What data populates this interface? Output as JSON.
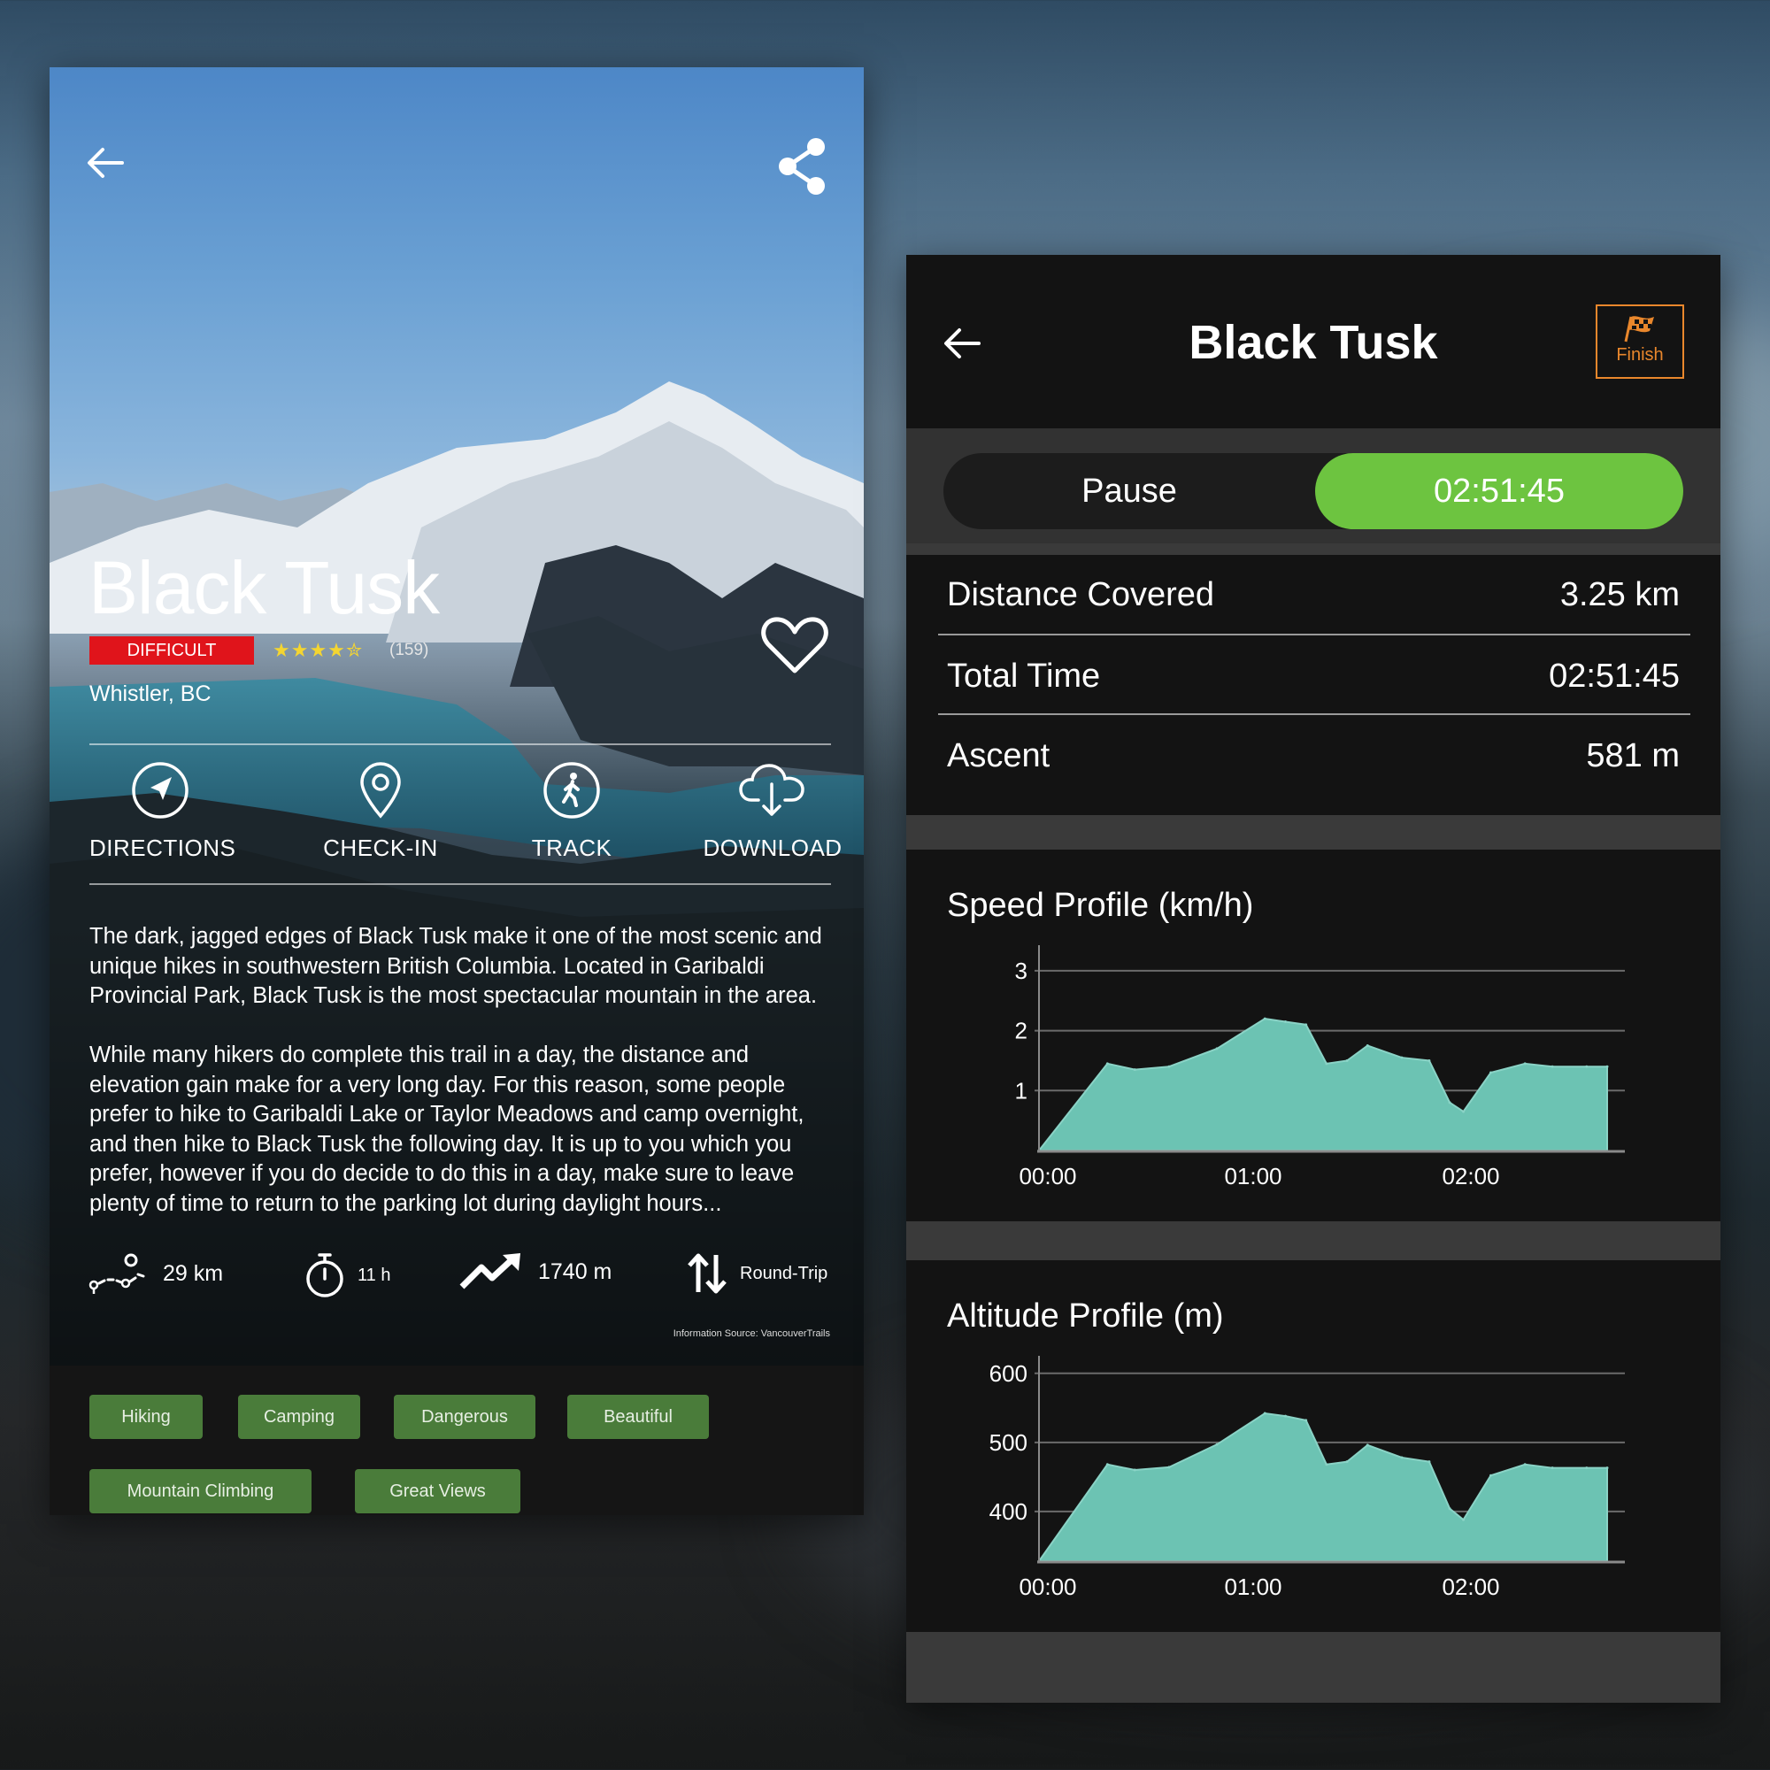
{
  "left": {
    "title": "Black Tusk",
    "difficulty": "DIFFICULT",
    "stars": "★★★★✮",
    "rating": 4.5,
    "review_count": "(159)",
    "location": "Whistler, BC",
    "actions": [
      {
        "label": "DIRECTIONS",
        "icon": "navigation-icon"
      },
      {
        "label": "CHECK-IN",
        "icon": "map-pin-icon"
      },
      {
        "label": "TRACK",
        "icon": "hiker-icon"
      },
      {
        "label": "DOWNLOAD",
        "icon": "cloud-download-icon"
      }
    ],
    "description": [
      "The dark, jagged edges of Black Tusk make it one of the most scenic and unique hikes in southwestern British Columbia. Located in Garibaldi Provincial Park, Black Tusk is the most spectacular mountain in the area.",
      "While many hikers do complete this trail in a day, the distance and elevation gain make for a very long day. For this reason, some people prefer to hike to Garibaldi Lake or Taylor Meadows and camp overnight, and then hike to Black Tusk the following day. It is up to you which you prefer, however if you do decide to do this in a day, make sure to leave plenty of time to return to the parking lot during daylight hours..."
    ],
    "stats": {
      "distance": "29 km",
      "duration": "11 h",
      "elevation": "1740 m",
      "route_type": "Round-Trip"
    },
    "source": "Information Source: VancouverTrails",
    "tags": [
      "Hiking",
      "Camping",
      "Dangerous",
      "Beautiful",
      "Mountain Climbing",
      "Great Views"
    ],
    "tag_color": "#4a7c3a",
    "difficulty_color": "#e0141b"
  },
  "right": {
    "title": "Black Tusk",
    "finish_label": "Finish",
    "pause_label": "Pause",
    "timer": "02:51:45",
    "accent": "#6dc440",
    "finish_color": "#e9872c",
    "metrics": [
      {
        "label": "Distance Covered",
        "value": "3.25 km"
      },
      {
        "label": "Total Time",
        "value": "02:51:45"
      },
      {
        "label": "Ascent",
        "value": "581 m"
      }
    ]
  },
  "chart_data": [
    {
      "type": "area",
      "title": "Speed Profile (km/h)",
      "x_ticks": [
        "00:00",
        "01:00",
        "02:00"
      ],
      "y_ticks": [
        "1",
        "2",
        "3"
      ],
      "ylim": [
        0,
        3.25
      ],
      "grid": true,
      "fill": "#6cc3b3",
      "x": [
        0,
        10,
        14,
        19,
        26,
        33,
        36,
        39,
        42,
        45,
        48,
        53,
        57,
        60,
        62,
        66,
        71,
        75,
        80,
        83
      ],
      "values": [
        0,
        1.45,
        1.35,
        1.4,
        1.7,
        2.2,
        2.15,
        2.1,
        1.45,
        1.5,
        1.75,
        1.55,
        1.5,
        0.8,
        0.65,
        1.3,
        1.45,
        1.4,
        1.4,
        1.4
      ]
    },
    {
      "type": "area",
      "title": "Altitude Profile (m)",
      "x_ticks": [
        "00:00",
        "01:00",
        "02:00"
      ],
      "y_ticks": [
        "400",
        "500",
        "600"
      ],
      "ylim": [
        328,
        610
      ],
      "grid": true,
      "fill": "#6cc3b3",
      "x": [
        0,
        10,
        14,
        19,
        26,
        33,
        36,
        39,
        42,
        45,
        48,
        53,
        57,
        60,
        62,
        66,
        71,
        75,
        80,
        83
      ],
      "values": [
        328,
        468,
        460,
        464,
        497,
        542,
        538,
        532,
        468,
        472,
        496,
        478,
        472,
        404,
        388,
        452,
        468,
        463,
        463,
        463
      ]
    }
  ]
}
